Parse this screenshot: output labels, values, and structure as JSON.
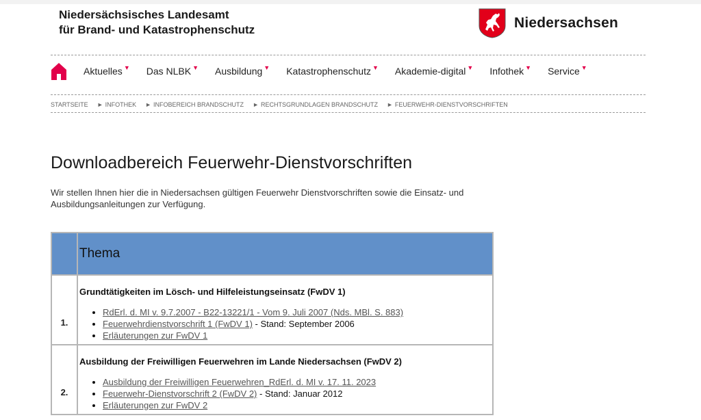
{
  "header": {
    "org_line1": "Niedersächsisches Landesamt",
    "org_line2": "für Brand- und Katastrophenschutz",
    "state_name": "Niedersachsen"
  },
  "nav": {
    "items": [
      {
        "label": "Aktuelles"
      },
      {
        "label": "Das NLBK"
      },
      {
        "label": "Ausbildung"
      },
      {
        "label": "Katastrophenschutz"
      },
      {
        "label": "Akademie-digital"
      },
      {
        "label": "Infothek"
      },
      {
        "label": "Service"
      }
    ],
    "dropdown_marker": "▼",
    "home_icon": "home-icon",
    "accent_color": "#e2004a"
  },
  "breadcrumb": {
    "separator": "►",
    "items": [
      "Startseite",
      "Infothek",
      "Infobereich Brandschutz",
      "Rechtsgrundlagen Brandschutz",
      "Feuerwehr-Dienstvorschriften"
    ]
  },
  "page": {
    "title": "Downloadbereich Feuerwehr-Dienstvorschriften",
    "intro": "Wir stellen Ihnen hier die in Niedersachsen gültigen Feuerwehr Dienstvorschriften sowie die Einsatz- und Ausbildungsanleitungen zur Verfügung."
  },
  "table": {
    "header_color": "#6190c9",
    "col_theme": "Thema",
    "rows": [
      {
        "num": "1.",
        "title": "Grundtätigkeiten im Lösch- und Hilfeleistungseinsatz (FwDV 1)",
        "links": [
          {
            "link": "RdErl. d. MI v. 9.7.2007 - B22-13221/1 - Vom 9. Juli 2007 (Nds. MBl. S. 883)",
            "suffix": ""
          },
          {
            "link": "Feuerwehrdienstvorschrift 1 (FwDV 1)",
            "suffix": " - Stand: September 2006"
          },
          {
            "link": "Erläuterungen zur FwDV 1",
            "suffix": ""
          }
        ]
      },
      {
        "num": "2.",
        "title": "Ausbildung der Freiwilligen Feuerwehren im Lande Niedersachsen (FwDV 2)",
        "links": [
          {
            "link": "Ausbildung der Freiwilligen Feuerwehren_RdErl. d. MI v. 17. 11. 2023",
            "suffix": ""
          },
          {
            "link": "Feuerwehr-Dienstvorschrift 2 (FwDV 2)",
            "suffix": " - Stand: Januar 2012"
          },
          {
            "link": "Erläuterungen zur FwDV 2",
            "suffix": ""
          }
        ]
      }
    ]
  }
}
